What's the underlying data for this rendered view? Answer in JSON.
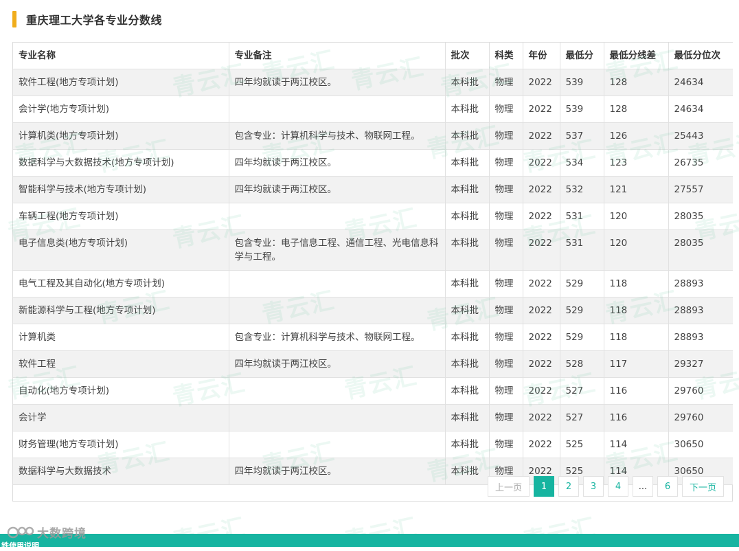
{
  "page": {
    "title": "重庆理工大学各专业分数线"
  },
  "table": {
    "headers": [
      "专业名称",
      "专业备注",
      "批次",
      "科类",
      "年份",
      "最低分",
      "最低分线差",
      "最低分位次"
    ],
    "rows": [
      [
        "软件工程(地方专项计划)",
        "四年均就读于两江校区。",
        "本科批",
        "物理",
        "2022",
        "539",
        "128",
        "24634"
      ],
      [
        "会计学(地方专项计划)",
        "",
        "本科批",
        "物理",
        "2022",
        "539",
        "128",
        "24634"
      ],
      [
        "计算机类(地方专项计划)",
        "包含专业：计算机科学与技术、物联网工程。",
        "本科批",
        "物理",
        "2022",
        "537",
        "126",
        "25443"
      ],
      [
        "数据科学与大数据技术(地方专项计划)",
        "四年均就读于两江校区。",
        "本科批",
        "物理",
        "2022",
        "534",
        "123",
        "26735"
      ],
      [
        "智能科学与技术(地方专项计划)",
        "四年均就读于两江校区。",
        "本科批",
        "物理",
        "2022",
        "532",
        "121",
        "27557"
      ],
      [
        "车辆工程(地方专项计划)",
        "",
        "本科批",
        "物理",
        "2022",
        "531",
        "120",
        "28035"
      ],
      [
        "电子信息类(地方专项计划)",
        "包含专业：电子信息工程、通信工程、光电信息科学与工程。",
        "本科批",
        "物理",
        "2022",
        "531",
        "120",
        "28035"
      ],
      [
        "电气工程及其自动化(地方专项计划)",
        "",
        "本科批",
        "物理",
        "2022",
        "529",
        "118",
        "28893"
      ],
      [
        "新能源科学与工程(地方专项计划)",
        "",
        "本科批",
        "物理",
        "2022",
        "529",
        "118",
        "28893"
      ],
      [
        "计算机类",
        "包含专业：计算机科学与技术、物联网工程。",
        "本科批",
        "物理",
        "2022",
        "529",
        "118",
        "28893"
      ],
      [
        "软件工程",
        "四年均就读于两江校区。",
        "本科批",
        "物理",
        "2022",
        "528",
        "117",
        "29327"
      ],
      [
        "自动化(地方专项计划)",
        "",
        "本科批",
        "物理",
        "2022",
        "527",
        "116",
        "29760"
      ],
      [
        "会计学",
        "",
        "本科批",
        "物理",
        "2022",
        "527",
        "116",
        "29760"
      ],
      [
        "财务管理(地方专项计划)",
        "",
        "本科批",
        "物理",
        "2022",
        "525",
        "114",
        "30650"
      ],
      [
        "数据科学与大数据技术",
        "四年均就读于两江校区。",
        "本科批",
        "物理",
        "2022",
        "525",
        "114",
        "30650"
      ]
    ]
  },
  "pagination": {
    "prev": "上一页",
    "pages": [
      "1",
      "2",
      "3",
      "4"
    ],
    "ellipsis": "...",
    "last": "6",
    "next": "下一页",
    "current": "1"
  },
  "watermark": {
    "text": "青云汇"
  },
  "footer": {
    "logo_text": "大数跨境",
    "band_text": "铁使用说明"
  },
  "colors": {
    "accent": "#f0ad1c",
    "brand": "#16b4a0",
    "row_alt": "#f2f2f2"
  }
}
